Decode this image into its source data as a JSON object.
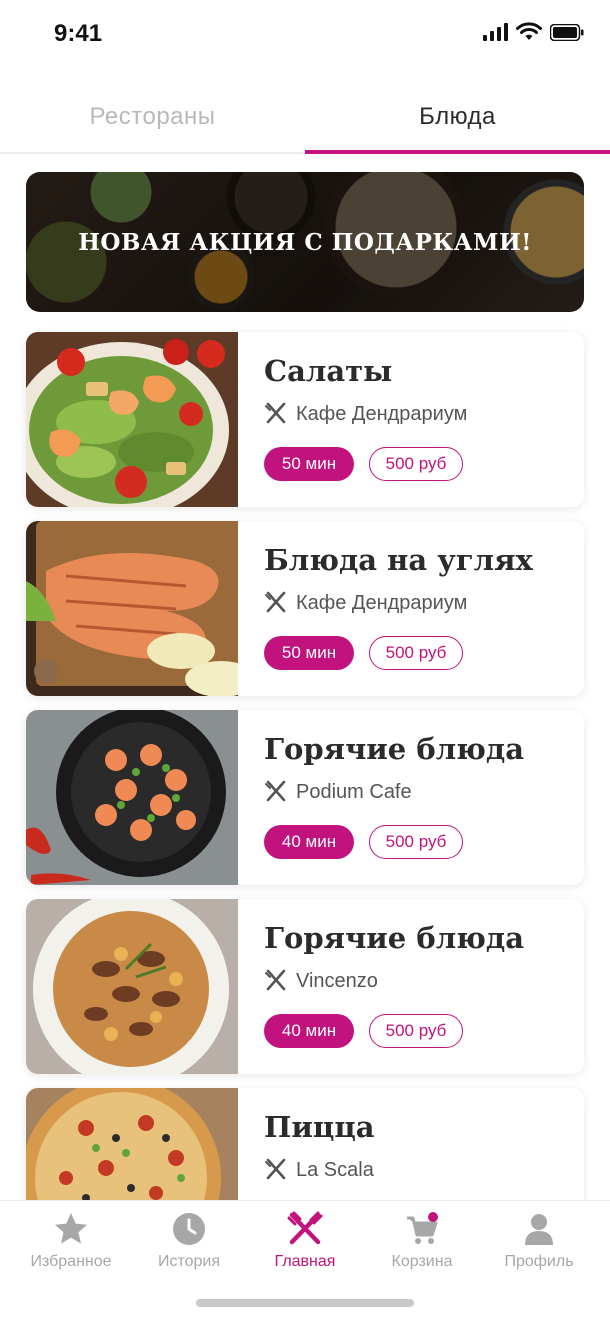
{
  "status_bar": {
    "time": "9:41"
  },
  "tabs": [
    {
      "label": "Рестораны",
      "active": false
    },
    {
      "label": "Блюда",
      "active": true
    }
  ],
  "banner": {
    "text": "НОВАЯ АКЦИЯ С ПОДАРКАМИ!"
  },
  "dishes": [
    {
      "title": "Салаты",
      "place": "Кафе Дендрариум",
      "time": "50 мин",
      "price": "500 руб"
    },
    {
      "title": "Блюда на углях",
      "place": "Кафе Дендрариум",
      "time": "50 мин",
      "price": "500 руб"
    },
    {
      "title": "Горячие блюда",
      "place": "Podium Cafe",
      "time": "40 мин",
      "price": "500 руб"
    },
    {
      "title": "Горячие блюда",
      "place": "Vincenzo",
      "time": "40 мин",
      "price": "500 руб"
    },
    {
      "title": "Пицца",
      "place": "La Scala",
      "time": "",
      "price": ""
    }
  ],
  "bottom_nav": [
    {
      "label": "Избранное",
      "icon": "star-icon",
      "active": false
    },
    {
      "label": "История",
      "icon": "clock-icon",
      "active": false
    },
    {
      "label": "Главная",
      "icon": "fork-knife-icon",
      "active": true
    },
    {
      "label": "Корзина",
      "icon": "cart-icon",
      "active": false,
      "badge": true
    },
    {
      "label": "Профиль",
      "icon": "user-icon",
      "active": false
    }
  ],
  "colors": {
    "accent": "#c2127e",
    "inactive": "#a7a7a7",
    "text": "#2b2b2b"
  }
}
